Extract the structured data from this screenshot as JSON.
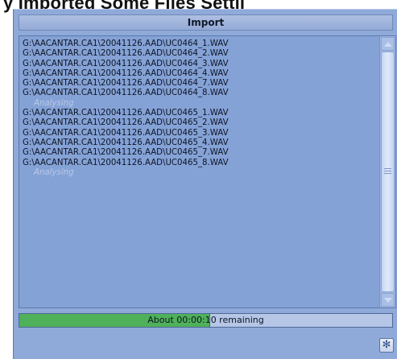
{
  "background": {
    "text": "y Imported Some Files   Settii"
  },
  "window": {
    "title": "Import"
  },
  "file_list": {
    "items": [
      {
        "text": "G:\\AACANTAR.CA1\\20041126.AAD\\UC0464_1.WAV",
        "kind": "file"
      },
      {
        "text": "G:\\AACANTAR.CA1\\20041126.AAD\\UC0464_2.WAV",
        "kind": "file"
      },
      {
        "text": "G:\\AACANTAR.CA1\\20041126.AAD\\UC0464_3.WAV",
        "kind": "file"
      },
      {
        "text": "G:\\AACANTAR.CA1\\20041126.AAD\\UC0464_4.WAV",
        "kind": "file"
      },
      {
        "text": "G:\\AACANTAR.CA1\\20041126.AAD\\UC0464_7.WAV",
        "kind": "file"
      },
      {
        "text": "G:\\AACANTAR.CA1\\20041126.AAD\\UC0464_8.WAV",
        "kind": "file"
      },
      {
        "text": "Analysing",
        "kind": "status"
      },
      {
        "text": "G:\\AACANTAR.CA1\\20041126.AAD\\UC0465_1.WAV",
        "kind": "file"
      },
      {
        "text": "G:\\AACANTAR.CA1\\20041126.AAD\\UC0465_2.WAV",
        "kind": "file"
      },
      {
        "text": "G:\\AACANTAR.CA1\\20041126.AAD\\UC0465_3.WAV",
        "kind": "file"
      },
      {
        "text": "G:\\AACANTAR.CA1\\20041126.AAD\\UC0465_4.WAV",
        "kind": "file"
      },
      {
        "text": "G:\\AACANTAR.CA1\\20041126.AAD\\UC0465_7.WAV",
        "kind": "file"
      },
      {
        "text": "G:\\AACANTAR.CA1\\20041126.AAD\\UC0465_8.WAV",
        "kind": "file"
      },
      {
        "text": "Analysing",
        "kind": "status"
      }
    ]
  },
  "progress": {
    "label": "About 00:00:10 remaining",
    "fraction": 0.51
  },
  "icons": {
    "scroll_up": "arrow-up-icon",
    "scroll_down": "arrow-down-icon",
    "settings": "asterisk-icon"
  },
  "colors": {
    "panel": "#8faad8",
    "progress_fill": "#4fb15a",
    "status_text": "#b9c8e6"
  }
}
